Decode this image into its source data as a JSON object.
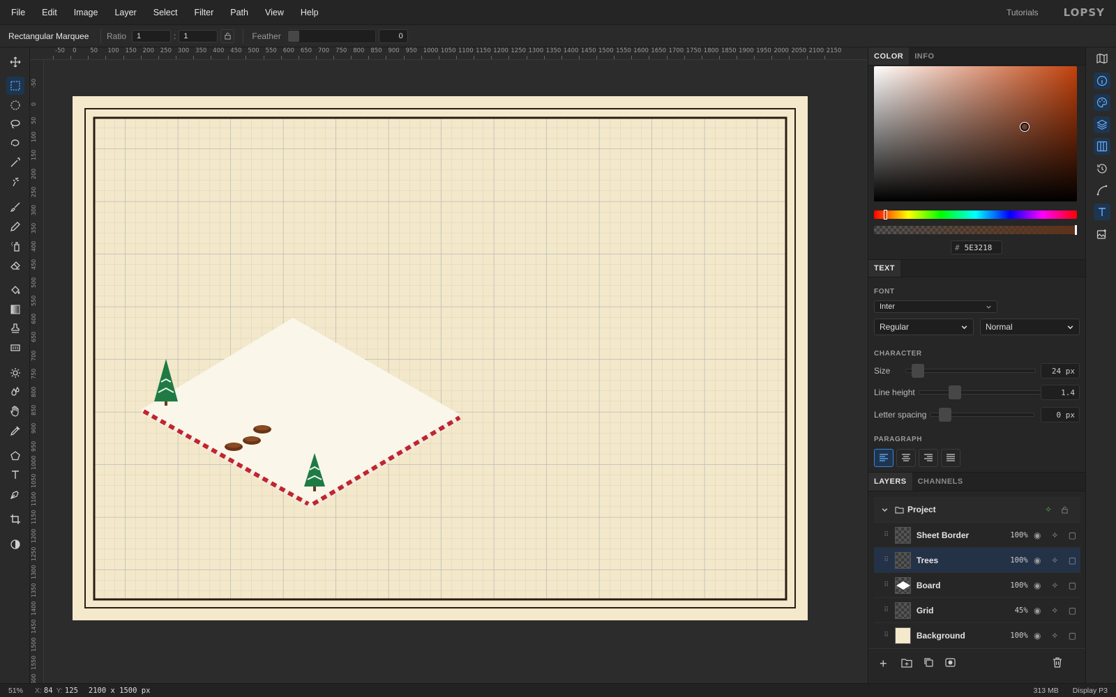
{
  "menubar": {
    "menus": [
      "File",
      "Edit",
      "Image",
      "Layer",
      "Select",
      "Filter",
      "Path",
      "View",
      "Help"
    ],
    "tutorials": "Tutorials",
    "logo": "LOPSY"
  },
  "options": {
    "tool_name": "Rectangular Marquee",
    "ratio_label": "Ratio",
    "ratio_w": "1",
    "ratio_sep": ":",
    "ratio_h": "1",
    "feather_label": "Feather",
    "feather_value": "0"
  },
  "tools": [
    "move-tool",
    "rect-marquee-tool",
    "ellipse-marquee-tool",
    "lasso-tool",
    "magnetic-lasso-tool",
    "magic-wand-tool",
    "quick-select-tool",
    "brush-tool",
    "pencil-tool",
    "spray-tool",
    "eraser-tool",
    "fill-tool",
    "gradient-tool",
    "stamp-tool",
    "pattern-tool",
    "dodge-tool",
    "burn-tool",
    "smudge-tool",
    "eyedropper-tool",
    "shape-tool",
    "text-tool",
    "pen-tool",
    "crop-tool",
    "contrast-tool"
  ],
  "ruler_top": [
    "-50",
    "0",
    "50",
    "100",
    "150",
    "200",
    "250",
    "300",
    "350",
    "400",
    "450",
    "500",
    "550",
    "600",
    "650",
    "700",
    "750",
    "800",
    "850",
    "900",
    "950",
    "1000",
    "1050",
    "1100",
    "1150",
    "1200",
    "1250",
    "1300",
    "1350",
    "1400",
    "1450",
    "1500",
    "1550",
    "1600",
    "1650",
    "1700",
    "1750",
    "1800",
    "1850",
    "1900",
    "1950",
    "2000",
    "2050",
    "2100",
    "2150"
  ],
  "ruler_left": [
    "-50",
    "0",
    "50",
    "100",
    "150",
    "200",
    "250",
    "300",
    "350",
    "400",
    "450",
    "500",
    "550",
    "600",
    "650",
    "700",
    "750",
    "800",
    "850",
    "900",
    "950",
    "1000",
    "1050",
    "1100",
    "1150",
    "1200",
    "1250",
    "1300",
    "1350",
    "1400",
    "1450",
    "1500",
    "1550",
    "1600"
  ],
  "color_panel": {
    "tabs": [
      "COLOR",
      "INFO"
    ],
    "hash": "#",
    "hex": "5E3218",
    "hue_color": "#c2410c",
    "current_color": "#5E3218"
  },
  "text_panel": {
    "tab": "TEXT",
    "font_label": "FONT",
    "font": "Inter",
    "weight": "Regular",
    "style": "Normal",
    "character_label": "CHARACTER",
    "size_label": "Size",
    "size_value": "24 px",
    "lineheight_label": "Line height",
    "lineheight_value": "1.4",
    "letterspacing_label": "Letter spacing",
    "letterspacing_value": "0 px",
    "paragraph_label": "PARAGRAPH"
  },
  "layers_panel": {
    "tabs": [
      "LAYERS",
      "CHANNELS"
    ],
    "group": "Project",
    "layers": [
      {
        "name": "Sheet Border",
        "opacity": "100%"
      },
      {
        "name": "Trees",
        "opacity": "100%"
      },
      {
        "name": "Board",
        "opacity": "100%"
      },
      {
        "name": "Grid",
        "opacity": "45%"
      },
      {
        "name": "Background",
        "opacity": "100%"
      }
    ]
  },
  "status": {
    "zoom": "51%",
    "x_label": "X:",
    "x": "84",
    "y_label": "Y:",
    "y": "125",
    "doc_size": "2100 x 1500 px",
    "memory": "313 MB",
    "display": "Display P3"
  }
}
